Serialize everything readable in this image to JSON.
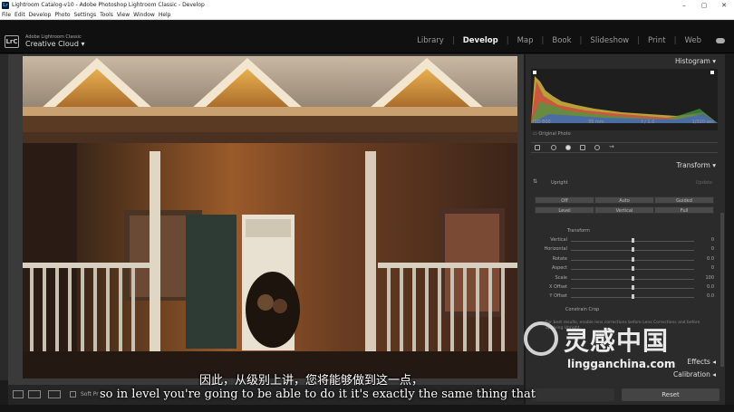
{
  "window": {
    "title": "Lightroom Catalog-v10 - Adobe Photoshop Lightroom Classic - Develop",
    "app_icon": "Lr",
    "controls": [
      "–",
      "▢",
      "✕"
    ]
  },
  "menu": [
    "File",
    "Edit",
    "Develop",
    "Photo",
    "Settings",
    "Tools",
    "View",
    "Window",
    "Help"
  ],
  "identity": {
    "logo": "LrC",
    "brand_small": "Adobe Lightroom Classic",
    "brand_big": "Creative Cloud",
    "dropdown": "▾"
  },
  "modules": {
    "items": [
      "Library",
      "Develop",
      "Map",
      "Book",
      "Slideshow",
      "Print",
      "Web"
    ],
    "active": "Develop",
    "sep": "|"
  },
  "right_panel": {
    "histogram": {
      "title": "Histogram",
      "iso": "ISO 800",
      "focal": "35 mm",
      "aperture": "f / 1.0",
      "shutter": "1/320 sec",
      "original": "Original Photo"
    },
    "transform": {
      "title": "Transform",
      "upright_label": "Upright",
      "upright_reset": "Update",
      "buttons_row1": [
        "Off",
        "Auto",
        "Guided"
      ],
      "buttons_row2": [
        "Level",
        "Vertical",
        "Full"
      ],
      "sub_title": "Transform",
      "sliders": [
        {
          "label": "Vertical",
          "value": "0",
          "pos": 0.5
        },
        {
          "label": "Horizontal",
          "value": "0",
          "pos": 0.5
        },
        {
          "label": "Rotate",
          "value": "0.0",
          "pos": 0.5
        },
        {
          "label": "Aspect",
          "value": "0",
          "pos": 0.5
        },
        {
          "label": "Scale",
          "value": "100",
          "pos": 0.5
        },
        {
          "label": "X Offset",
          "value": "0.0",
          "pos": 0.5
        },
        {
          "label": "Y Offset",
          "value": "0.0",
          "pos": 0.5
        }
      ],
      "constrain": "Constrain Crop",
      "help": "For best results, enable lens corrections before Lens Corrections and before applying Upright."
    },
    "effects": "Effects",
    "calibration": "Calibration",
    "reset": "Reset"
  },
  "toolbar": {
    "soft_proof": "Soft Pr"
  },
  "subtitles": {
    "cn": "因此，从级别上讲，您将能够做到这一点，",
    "en": "so in level you're going to be able to do it it's exactly the same thing that"
  },
  "watermark": {
    "cn": "灵感中国",
    "url": "lingganchina.com"
  },
  "colors": {
    "accent": "#f0f0f0",
    "panel": "#2b2b2b"
  }
}
